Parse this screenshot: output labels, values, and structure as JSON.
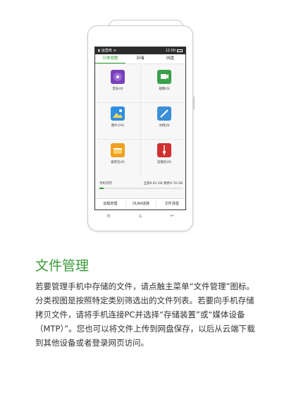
{
  "status_bar": {
    "carrier": "运营商",
    "time": "12:00"
  },
  "tabs": [
    {
      "label": "分类视图",
      "active": true
    },
    {
      "label": "存储",
      "active": false
    },
    {
      "label": "网盘",
      "active": false
    }
  ],
  "categories": [
    {
      "label": "音乐(0)",
      "icon": "music-icon",
      "color": "#7a3fb8"
    },
    {
      "label": "视频(0)",
      "icon": "video-icon",
      "color": "#3aa14b"
    },
    {
      "label": "图片(24)",
      "icon": "picture-icon",
      "color": "#2f8fe0"
    },
    {
      "label": "文档(0)",
      "icon": "document-icon",
      "color": "#3b8fd6"
    },
    {
      "label": "安装包(0)",
      "icon": "package-icon",
      "color": "#f0a020"
    },
    {
      "label": "压缩包(0)",
      "icon": "archive-icon",
      "color": "#d03030"
    }
  ],
  "storage": {
    "label": "手机内存",
    "total": "全部9.81 GB",
    "remaining": "剩余9.78 GB",
    "used_fraction": 0.05
  },
  "bottom_bar": [
    "远程管理",
    "DLNA连接",
    "文件清理"
  ],
  "nav_keys": [
    "menu-key-icon",
    "home-key-icon",
    "back-key-icon"
  ],
  "caption": {
    "title": "文件管理",
    "body": "若要管理手机中存储的文件，请点触主菜单“文件管理”图标。分类视图是按照特定类别筛选出的文件列表。若要向手机存储拷贝文件，请将手机连接PC并选择“存储装置”或“媒体设备（MTP）”。您也可以将文件上传到网盘保存，以后从云端下载到其他设备或者登录网页访问。"
  },
  "colors": {
    "accent": "#3a9a3a"
  }
}
